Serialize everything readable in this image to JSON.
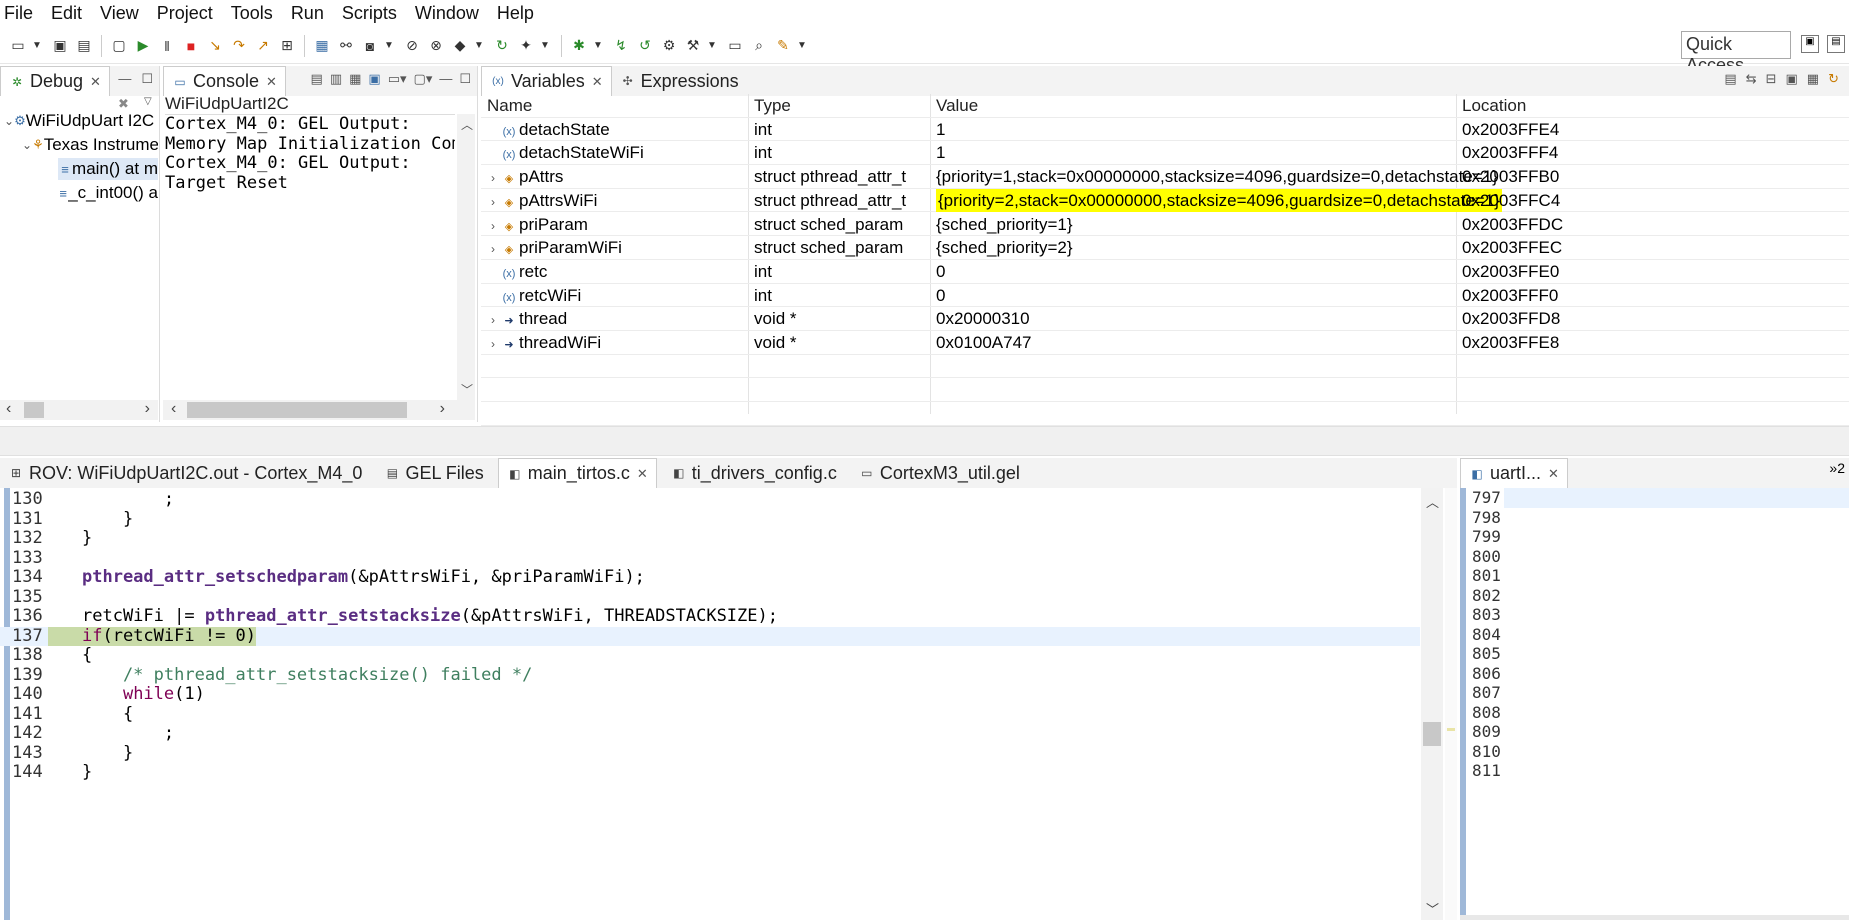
{
  "menu": [
    "File",
    "Edit",
    "View",
    "Project",
    "Tools",
    "Run",
    "Scripts",
    "Window",
    "Help"
  ],
  "toolbar": {
    "quick_access_label": "Quick Access",
    "icons": [
      "new-icon",
      "save-icon",
      "save-all-icon",
      "debug-view-icon",
      "resume-icon",
      "suspend-icon",
      "terminate-icon",
      "step-into-icon",
      "step-over-icon",
      "step-return-icon",
      "table-icon",
      "connect-icon",
      "link-icon",
      "memory-icon",
      "reset-icon",
      "restart-icon",
      "load-icon",
      "gear-icon",
      "run-to-line-icon",
      "build-icon",
      "hammer-icon",
      "window-icon",
      "search-icon",
      "pin-icon"
    ]
  },
  "debug": {
    "tab_label": "Debug",
    "tree": [
      {
        "label": "WiFiUdpUart I2C [",
        "level": 0
      },
      {
        "label": "Texas Instrume",
        "level": 1
      },
      {
        "label": "main() at m",
        "level": 2
      },
      {
        "label": "_c_int00() a",
        "level": 2
      }
    ]
  },
  "console": {
    "tab_label": "Console",
    "title": "WiFiUdpUartI2C",
    "lines": [
      "Cortex_M4_0: GEL Output:",
      "Memory Map Initialization Compl",
      "Cortex_M4_0: GEL Output:",
      "Target Reset"
    ]
  },
  "variables": {
    "tabs": [
      "Variables",
      "Expressions"
    ],
    "columns": [
      "Name",
      "Type",
      "Value",
      "Location"
    ],
    "rows": [
      {
        "name": "detachState",
        "type": "int",
        "value": "1",
        "location": "0x2003FFE4",
        "expandable": false,
        "kind": "prim"
      },
      {
        "name": "detachStateWiFi",
        "type": "int",
        "value": "1",
        "location": "0x2003FFF4",
        "expandable": false,
        "kind": "prim"
      },
      {
        "name": "pAttrs",
        "type": "struct pthread_attr_t",
        "value": "{priority=1,stack=0x00000000,stacksize=4096,guardsize=0,detachstate=1}",
        "location": "0x2003FFB0",
        "expandable": true,
        "kind": "struct"
      },
      {
        "name": "pAttrsWiFi",
        "type": "struct pthread_attr_t",
        "value": "{priority=2,stack=0x00000000,stacksize=4096,guardsize=0,detachstate=1}",
        "location": "0x2003FFC4",
        "expandable": true,
        "kind": "struct",
        "highlight": true
      },
      {
        "name": "priParam",
        "type": "struct sched_param",
        "value": "{sched_priority=1}",
        "location": "0x2003FFDC",
        "expandable": true,
        "kind": "struct"
      },
      {
        "name": "priParamWiFi",
        "type": "struct sched_param",
        "value": "{sched_priority=2}",
        "location": "0x2003FFEC",
        "expandable": true,
        "kind": "struct"
      },
      {
        "name": "retc",
        "type": "int",
        "value": "0",
        "location": "0x2003FFE0",
        "expandable": false,
        "kind": "prim"
      },
      {
        "name": "retcWiFi",
        "type": "int",
        "value": "0",
        "location": "0x2003FFF0",
        "expandable": false,
        "kind": "prim"
      },
      {
        "name": "thread",
        "type": "void *",
        "value": "0x20000310",
        "location": "0x2003FFD8",
        "expandable": true,
        "kind": "ptr"
      },
      {
        "name": "threadWiFi",
        "type": "void *",
        "value": "0x0100A747",
        "location": "0x2003FFE8",
        "expandable": true,
        "kind": "ptr"
      }
    ]
  },
  "editor": {
    "tabs": [
      {
        "label": "ROV: WiFiUdpUartI2C.out - Cortex_M4_0",
        "icon": "table-icon",
        "active": false
      },
      {
        "label": "GEL Files",
        "icon": "gel-icon",
        "active": false
      },
      {
        "label": "main_tirtos.c",
        "icon": "c-file-icon",
        "active": true
      },
      {
        "label": "ti_drivers_config.c",
        "icon": "c-file-icon",
        "active": false
      },
      {
        "label": "CortexM3_util.gel",
        "icon": "file-icon",
        "active": false
      }
    ],
    "lines": [
      {
        "n": "130",
        "parts": [
          {
            "t": "        ;",
            "c": ""
          }
        ]
      },
      {
        "n": "131",
        "parts": [
          {
            "t": "    }",
            "c": ""
          }
        ]
      },
      {
        "n": "132",
        "parts": [
          {
            "t": "}",
            "c": ""
          }
        ]
      },
      {
        "n": "133",
        "parts": [
          {
            "t": "",
            "c": ""
          }
        ]
      },
      {
        "n": "134",
        "parts": [
          {
            "t": "pthread_attr_setschedparam",
            "c": "fn"
          },
          {
            "t": "(&pAttrsWiFi, &priParamWiFi);",
            "c": ""
          }
        ]
      },
      {
        "n": "135",
        "parts": [
          {
            "t": "",
            "c": ""
          }
        ]
      },
      {
        "n": "136",
        "parts": [
          {
            "t": "retcWiFi |= ",
            "c": ""
          },
          {
            "t": "pthread_attr_setstacksize",
            "c": "fn"
          },
          {
            "t": "(&pAttrsWiFi, THREADSTACKSIZE);",
            "c": ""
          }
        ]
      },
      {
        "n": "137",
        "parts": [
          {
            "t": "if",
            "c": "kw"
          },
          {
            "t": "(retcWiFi != 0)",
            "c": ""
          }
        ],
        "current": true
      },
      {
        "n": "138",
        "parts": [
          {
            "t": "{",
            "c": ""
          }
        ]
      },
      {
        "n": "139",
        "parts": [
          {
            "t": "    /* pthread_attr_setstacksize() failed */",
            "c": "cm"
          }
        ]
      },
      {
        "n": "140",
        "parts": [
          {
            "t": "    ",
            "c": ""
          },
          {
            "t": "while",
            "c": "kw"
          },
          {
            "t": "(1)",
            "c": ""
          }
        ]
      },
      {
        "n": "141",
        "parts": [
          {
            "t": "    {",
            "c": ""
          }
        ]
      },
      {
        "n": "142",
        "parts": [
          {
            "t": "        ;",
            "c": ""
          }
        ]
      },
      {
        "n": "143",
        "parts": [
          {
            "t": "    }",
            "c": ""
          }
        ]
      },
      {
        "n": "144",
        "parts": [
          {
            "t": "}",
            "c": ""
          }
        ]
      }
    ]
  },
  "uart_editor": {
    "tab_label": "uartI...",
    "overflow_label": "»2",
    "lines": [
      "797",
      "798",
      "799",
      "800",
      "801",
      "802",
      "803",
      "804",
      "805",
      "806",
      "807",
      "808",
      "809",
      "810",
      "811"
    ]
  },
  "colors": {
    "highlight_yellow": "#ffff00",
    "current_line": "#e8f2fe",
    "breakpoint_green": "#c9dba8",
    "function_purple": "#5a2d82",
    "keyword": "#7f0055",
    "comment": "#3f7f5f"
  }
}
